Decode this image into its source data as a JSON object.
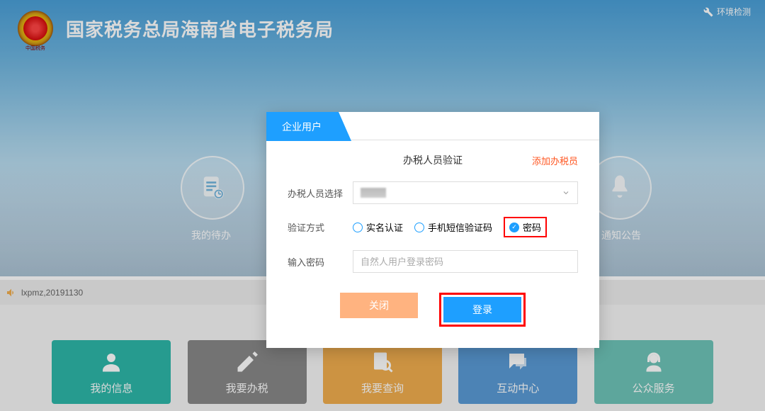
{
  "header": {
    "title": "国家税务总局海南省电子税务局",
    "logo_ribbon": "中国税务",
    "env_check": "环境检测"
  },
  "circles": {
    "left_label": "我的待办",
    "right_label": "通知公告"
  },
  "status": {
    "text": "lxpmz,20191130"
  },
  "tiles": [
    {
      "label": "我的信息"
    },
    {
      "label": "我要办税"
    },
    {
      "label": "我要查询"
    },
    {
      "label": "互动中心"
    },
    {
      "label": "公众服务"
    }
  ],
  "dialog": {
    "tab": "企业用户",
    "section_title": "办税人员验证",
    "add_link": "添加办税员",
    "labels": {
      "person_select": "办税人员选择",
      "verify_method": "验证方式",
      "password_input": "输入密码"
    },
    "radios": {
      "realname": "实名认证",
      "sms": "手机短信验证码",
      "password": "密码"
    },
    "password_placeholder": "自然人用户登录密码",
    "btn_close": "关闭",
    "btn_login": "登录"
  }
}
